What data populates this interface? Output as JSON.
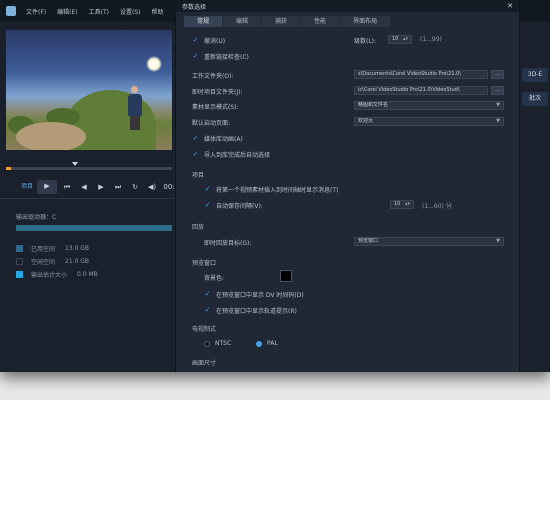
{
  "menubar": {
    "items": [
      "文件(F)",
      "编辑(E)",
      "工具(T)",
      "设置(S)",
      "帮助"
    ]
  },
  "player": {
    "mode_label": "项目",
    "time_label": "00:"
  },
  "output": {
    "title": "输出驱动器：C",
    "legend": [
      {
        "label": "已用空间",
        "value": "13.0 GB",
        "color": "#2f6a8c"
      },
      {
        "label": "空闲空间",
        "value": "21.0 GB",
        "color": "#1a2230"
      },
      {
        "label": "输出估计大小",
        "value": "0.0 MB",
        "color": "#25a8e6"
      }
    ]
  },
  "right_buttons": [
    "3D-E",
    "批次"
  ],
  "dialog": {
    "title": "参数选择",
    "close": "✕",
    "tabs": [
      "常规",
      "编辑",
      "捕获",
      "性能",
      "界面布局"
    ],
    "active_tab": 0,
    "undo_label": "撤消(U)",
    "undo_levels_label": "级数(L):",
    "undo_levels_value": "10",
    "undo_levels_range": "(1...99)",
    "relink_label": "重新链接检查(C)",
    "work_folder_label": "工作文件夹(O):",
    "work_folder_value": "s\\Documents\\Corel VideoStudio Pro\\21.0\\",
    "instant_folder_label": "即时项目文件夹(J):",
    "instant_folder_value": "ic\\Corel VideoStudio Pro\\21.0\\VideoStud\\",
    "browse_label": "...",
    "material_mode_label": "素材显示模式(S):",
    "material_mode_value": "略图和文件名",
    "default_page_label": "默认启动页面:",
    "default_page_value": "欢迎页",
    "media_sync_label": "媒体库动画(A)",
    "zoom_label": "导入到库完成后自动选择",
    "project_section": "项目",
    "insert_label": "将第一个视频素材插入到时间轴时显示消息(T)",
    "autosave_label": "自动保存间隔(V):",
    "autosave_value": "10",
    "autosave_range": "(1...60) 分",
    "playback_section": "回放",
    "instant_playback_label": "即时回放目标(G):",
    "instant_playback_value": "预览窗口",
    "preview_section": "预览窗口",
    "bg_color_label": "背景色:",
    "show_title_safe_label": "在预览窗口中显示 DV 时间码(D)",
    "show_track_label": "在预览窗口中显示轨道提示(R)",
    "video_standard_section": "电视制式",
    "ntsc_label": "NTSC",
    "pal_label": "PAL",
    "pal_selected": true,
    "last_section": "画面尺寸"
  }
}
